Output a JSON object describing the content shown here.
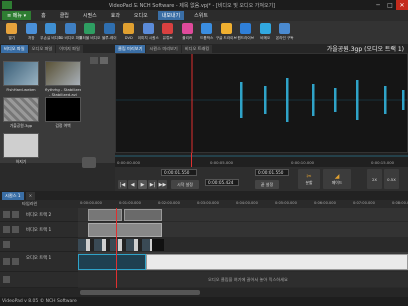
{
  "window": {
    "title": "VideoPad 도 NCH Software - 제목 없음.vpj* - [비디오 및 오디오 가져오기]",
    "icons": [
      "minimize-icon",
      "maximize-icon",
      "close-icon"
    ],
    "minimize_glyph": "─",
    "maximize_glyph": "□",
    "close_glyph": "✕"
  },
  "menu": {
    "main": "≡ 메뉴 ▾",
    "items": [
      "홈",
      "클립",
      "시퀀스",
      "효과",
      "오디오",
      "내보내기",
      "스위트"
    ],
    "active_index": 5
  },
  "toolbar": {
    "buttons": [
      {
        "label": "열기",
        "color": "#e6a23c"
      },
      {
        "label": "저장",
        "color": "#4a90d9"
      },
      {
        "label": "무손실 비디오",
        "color": "#3f8fd2"
      },
      {
        "label": "3D 비디오 파일",
        "color": "#3f7fc2"
      },
      {
        "label": "포터블 비디오",
        "color": "#2e9e62"
      },
      {
        "label": "블루-레이",
        "color": "#2f6fb0"
      },
      {
        "label": "DVD",
        "color": "#e0a030"
      },
      {
        "label": "이미지 시퀀스",
        "color": "#5b8bd9"
      },
      {
        "label": "유튜브",
        "color": "#d94040"
      },
      {
        "label": "플리커",
        "color": "#e04a9b"
      },
      {
        "label": "드롭박스",
        "color": "#3a8de0"
      },
      {
        "label": "구글 드라이브",
        "color": "#f0b030"
      },
      {
        "label": "원드라이브",
        "color": "#2f7fd8"
      },
      {
        "label": "비메오",
        "color": "#31a8e0"
      },
      {
        "label": "온라인 구독",
        "color": "#4a8ad0"
      }
    ]
  },
  "bin": {
    "tabs": [
      "비디오 파일",
      "오디오 파일",
      "이미지 파일"
    ],
    "selected": 0,
    "clips": [
      {
        "label": "FishHard.webm",
        "color": "#4c6e86"
      },
      {
        "label": "flythrhg - Stabilized",
        "label2": "- Stabilized.avi",
        "color": "#6a6040"
      },
      {
        "label": "가을공원.3gp",
        "color": "#8a8a8a"
      },
      {
        "label": "검정 여백",
        "color": "#000000"
      },
      {
        "label": "하지기",
        "color": "#c8c8c8"
      }
    ],
    "camera_icon": "camera-icon"
  },
  "preview": {
    "tabs": [
      "클립 미리보기",
      "시퀀스 미리보기",
      "비디오 트래킹"
    ],
    "selected": 0,
    "clip_title": "가을공원.3gp (오디오 트랙 1)",
    "ruler_labels": [
      "0:00:00.000",
      "0:00:05.000",
      "0:00:10.000",
      "0:00:15.000"
    ],
    "timecode_start": "0:00:01.550",
    "timecode_end": "0:00:01.550",
    "duration": "0:00:05.424",
    "set_start": "시작 설정",
    "set_end": "끝 설정",
    "split_label": "분할",
    "fade_label": "페이드",
    "zoom_labels": [
      "2X",
      "0.5X"
    ]
  },
  "sequence": {
    "tabs": [
      "시퀀스 1",
      "×"
    ],
    "timeline_label": "타임라인",
    "ruler": [
      "0:00:00.000",
      "0:01:00.000",
      "0:02:00.000",
      "0:03:00.000",
      "0:04:00.000",
      "0:05:00.000",
      "0:06:00.000",
      "0:07:00.000",
      "0:08:00.000"
    ],
    "tracks": [
      {
        "name": "비디오 트랙 2"
      },
      {
        "name": "비디오 트랙 1"
      },
      {
        "name": "오디오 트랙 1"
      },
      {
        "name": ""
      }
    ],
    "drop_message": "오디오 클립을 여기에 끌어서 놓아 믹스하세요"
  },
  "status": {
    "text": "VideoPad v 8.05 © NCH Software"
  },
  "colors": {
    "accent": "#3a6ea5",
    "wave": "#2fa3c8",
    "playhead": "#e03030",
    "main_menu": "#2e7d32"
  }
}
